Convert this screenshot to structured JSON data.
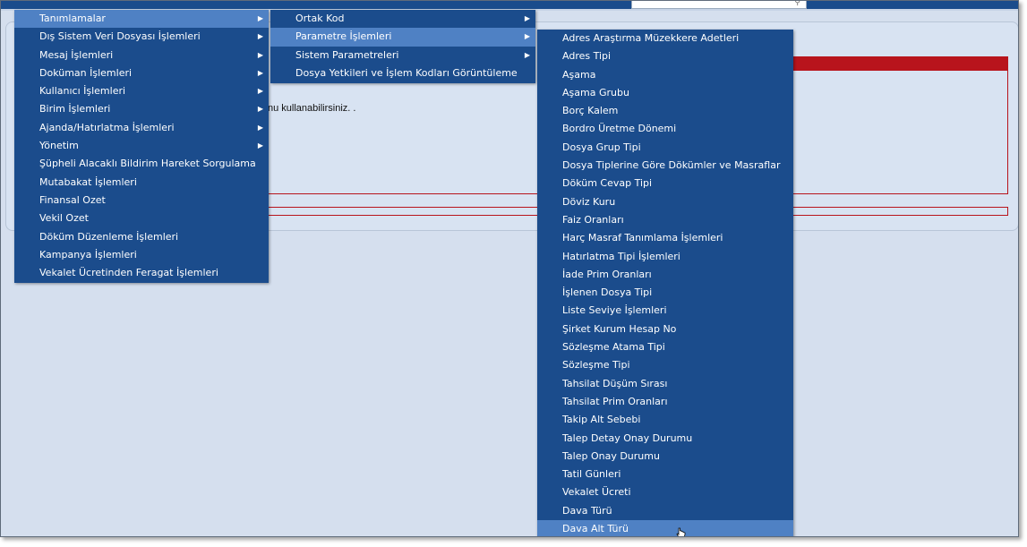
{
  "info": {
    "text": "nu kullanabilirsiniz. ."
  },
  "menu_level1": {
    "items": [
      {
        "label": "Tanımlamalar",
        "submenu": true
      },
      {
        "label": "Dış Sistem Veri Dosyası İşlemleri",
        "submenu": true
      },
      {
        "label": "Mesaj İşlemleri",
        "submenu": true
      },
      {
        "label": "Doküman İşlemleri",
        "submenu": true
      },
      {
        "label": "Kullanıcı İşlemleri",
        "submenu": true
      },
      {
        "label": "Birim İşlemleri",
        "submenu": true
      },
      {
        "label": "Ajanda/Hatırlatma İşlemleri",
        "submenu": true
      },
      {
        "label": "Yönetim",
        "submenu": true
      },
      {
        "label": "Şüpheli Alacaklı Bildirim Hareket Sorgulama",
        "submenu": false
      },
      {
        "label": "Mutabakat İşlemleri",
        "submenu": false
      },
      {
        "label": "Finansal Ozet",
        "submenu": false
      },
      {
        "label": "Vekil Ozet",
        "submenu": false
      },
      {
        "label": "Döküm Düzenleme İşlemleri",
        "submenu": false
      },
      {
        "label": "Kampanya İşlemleri",
        "submenu": false
      },
      {
        "label": "Vekalet Ücretinden Feragat İşlemleri",
        "submenu": false
      }
    ]
  },
  "menu_level2": {
    "items": [
      {
        "label": "Ortak Kod",
        "submenu": true
      },
      {
        "label": "Parametre İşlemleri",
        "submenu": true
      },
      {
        "label": "Sistem Parametreleri",
        "submenu": true
      },
      {
        "label": "Dosya Yetkileri ve İşlem Kodları Görüntüleme",
        "submenu": false
      }
    ]
  },
  "menu_level3": {
    "items": [
      {
        "label": "Adres Araştırma Müzekkere Adetleri"
      },
      {
        "label": "Adres Tipi"
      },
      {
        "label": "Aşama"
      },
      {
        "label": "Aşama Grubu"
      },
      {
        "label": "Borç Kalem"
      },
      {
        "label": "Bordro Üretme Dönemi"
      },
      {
        "label": "Dosya Grup Tipi"
      },
      {
        "label": "Dosya Tiplerine Göre Dökümler ve Masraflar"
      },
      {
        "label": "Döküm Cevap Tipi"
      },
      {
        "label": "Döviz Kuru"
      },
      {
        "label": "Faiz Oranları"
      },
      {
        "label": "Harç Masraf Tanımlama İşlemleri"
      },
      {
        "label": "Hatırlatma Tipi İşlemleri"
      },
      {
        "label": "İade Prim Oranları"
      },
      {
        "label": "İşlenen Dosya Tipi"
      },
      {
        "label": "Liste Seviye İşlemleri"
      },
      {
        "label": "Şirket Kurum Hesap No"
      },
      {
        "label": "Sözleşme Atama Tipi"
      },
      {
        "label": "Sözleşme Tipi"
      },
      {
        "label": "Tahsilat Düşüm Sırası"
      },
      {
        "label": "Tahsilat Prim Oranları"
      },
      {
        "label": "Takip Alt Sebebi"
      },
      {
        "label": "Talep Detay Onay Durumu"
      },
      {
        "label": "Talep Onay Durumu"
      },
      {
        "label": "Tatil Günleri"
      },
      {
        "label": "Vekalet Ücreti"
      },
      {
        "label": "Dava Türü"
      },
      {
        "label": "Dava Alt Türü"
      }
    ]
  },
  "colors": {
    "menu_bg": "#1b4c8c",
    "menu_active": "#4f81c4",
    "page_bg": "#d5dfee",
    "accent_red": "#b8141c"
  },
  "icons": {
    "submenu": "triangle-right-icon",
    "search": "search-icon",
    "cursor": "hand-pointer-icon"
  }
}
